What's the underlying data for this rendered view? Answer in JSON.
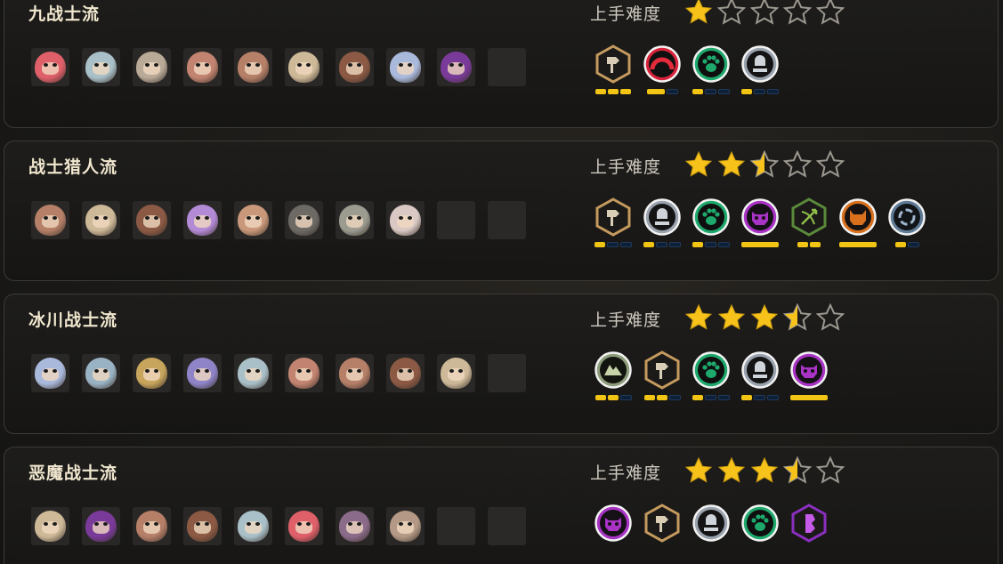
{
  "difficulty_label": "上手难度",
  "colors": {
    "star_on": "#f7c21a",
    "bar_on": "#f2c514",
    "bar_off": "#0e2038"
  },
  "lineups": [
    {
      "name": "九战士流",
      "difficulty": 1,
      "champions": [
        {
          "icon": "pig-warrior-icon",
          "color": "#e0606a"
        },
        {
          "icon": "frost-yeti-icon",
          "color": "#a9c0c8"
        },
        {
          "icon": "stone-golem-icon",
          "color": "#b9aa98"
        },
        {
          "icon": "masked-cat-icon",
          "color": "#c28470"
        },
        {
          "icon": "goggle-pig-icon",
          "color": "#b57f68"
        },
        {
          "icon": "bandana-knight-icon",
          "color": "#cdb898"
        },
        {
          "icon": "bearded-dwarf-icon",
          "color": "#8c5a44"
        },
        {
          "icon": "white-walrus-icon",
          "color": "#a9b9dc"
        },
        {
          "icon": "purple-demon-icon",
          "color": "#7a3a9a"
        },
        {
          "icon": "empty-slot",
          "color": ""
        }
      ],
      "traits": [
        {
          "icon": "warrior-axe-icon",
          "color": "#c59a5e",
          "shape": "hex",
          "bars": [
            1,
            1,
            1
          ]
        },
        {
          "icon": "red-arc-icon",
          "color": "#d8233a",
          "shape": "circle",
          "bars": [
            2,
            0
          ]
        },
        {
          "icon": "beast-paw-icon",
          "color": "#1ea86c",
          "shape": "circle",
          "bars": [
            1,
            0,
            0
          ]
        },
        {
          "icon": "gray-crest-icon",
          "color": "#9aa2ad",
          "shape": "circle",
          "bars": [
            1,
            0,
            0
          ]
        }
      ]
    },
    {
      "name": "战士猎人流",
      "difficulty": 2.5,
      "champions": [
        {
          "icon": "goggle-pig-icon",
          "color": "#b57f68"
        },
        {
          "icon": "bandana-knight-icon",
          "color": "#cdb898"
        },
        {
          "icon": "bearded-dwarf-icon",
          "color": "#8c5a44"
        },
        {
          "icon": "purple-witch-icon",
          "color": "#b38ad6"
        },
        {
          "icon": "goggle-dwarf-icon",
          "color": "#c9987a"
        },
        {
          "icon": "hooded-archer-icon",
          "color": "#6d6a66"
        },
        {
          "icon": "cyborg-icon",
          "color": "#9b9b90"
        },
        {
          "icon": "elder-sage-icon",
          "color": "#d9c8c4"
        },
        {
          "icon": "empty-slot",
          "color": ""
        },
        {
          "icon": "empty-slot",
          "color": ""
        }
      ],
      "traits": [
        {
          "icon": "warrior-axe-icon",
          "color": "#c59a5e",
          "shape": "hex",
          "bars": [
            1,
            0,
            0
          ]
        },
        {
          "icon": "gray-crest-icon",
          "color": "#9aa2ad",
          "shape": "circle",
          "bars": [
            1,
            0,
            0
          ]
        },
        {
          "icon": "beast-paw-icon",
          "color": "#1ea86c",
          "shape": "circle",
          "bars": [
            1,
            0,
            0
          ]
        },
        {
          "icon": "demon-skull-icon",
          "color": "#a833c4",
          "shape": "circle",
          "bars": [
            3
          ]
        },
        {
          "icon": "hunter-bow-icon",
          "color": "#5a8a3a",
          "shape": "hex",
          "bars": [
            1,
            1
          ]
        },
        {
          "icon": "orc-head-icon",
          "color": "#d8701e",
          "shape": "circle",
          "bars": [
            3
          ]
        },
        {
          "icon": "blue-spiral-icon",
          "color": "#5f7b96",
          "shape": "circle",
          "bars": [
            1,
            0
          ]
        }
      ]
    },
    {
      "name": "冰川战士流",
      "difficulty": 3.5,
      "champions": [
        {
          "icon": "white-walrus-icon",
          "color": "#a9b9dc"
        },
        {
          "icon": "horned-ice-icon",
          "color": "#9ab3c4"
        },
        {
          "icon": "gold-mummy-icon",
          "color": "#c7a55c"
        },
        {
          "icon": "ice-bat-icon",
          "color": "#8f84c8"
        },
        {
          "icon": "frost-yeti-icon",
          "color": "#a9c0c8"
        },
        {
          "icon": "masked-cat-icon",
          "color": "#c28470"
        },
        {
          "icon": "goggle-pig-icon",
          "color": "#b57f68"
        },
        {
          "icon": "bearded-dwarf-icon",
          "color": "#8c5a44"
        },
        {
          "icon": "bandana-knight-icon",
          "color": "#cdb898"
        },
        {
          "icon": "empty-slot",
          "color": ""
        }
      ],
      "traits": [
        {
          "icon": "glacier-icon",
          "color": "#8d9c7a",
          "shape": "circle",
          "bars": [
            1,
            1,
            0
          ]
        },
        {
          "icon": "warrior-axe-icon",
          "color": "#c59a5e",
          "shape": "hex",
          "bars": [
            1,
            1,
            0
          ]
        },
        {
          "icon": "beast-paw-icon",
          "color": "#1ea86c",
          "shape": "circle",
          "bars": [
            1,
            0,
            0
          ]
        },
        {
          "icon": "gray-crest-icon",
          "color": "#9aa2ad",
          "shape": "circle",
          "bars": [
            1,
            0,
            0
          ]
        },
        {
          "icon": "demon-skull-icon",
          "color": "#a833c4",
          "shape": "circle",
          "bars": [
            3
          ]
        }
      ]
    },
    {
      "name": "恶魔战士流",
      "difficulty": 3.5,
      "champions": [
        {
          "icon": "bandana-knight-icon",
          "color": "#cdb898"
        },
        {
          "icon": "purple-demon-icon",
          "color": "#7a3a9a"
        },
        {
          "icon": "goggle-pig-icon",
          "color": "#b57f68"
        },
        {
          "icon": "bearded-dwarf-icon",
          "color": "#8c5a44"
        },
        {
          "icon": "frost-yeti-icon",
          "color": "#a9c0c8"
        },
        {
          "icon": "pig-warrior-icon",
          "color": "#e0606a"
        },
        {
          "icon": "hooded-ghost-icon",
          "color": "#8b6b8a"
        },
        {
          "icon": "horned-beast-icon",
          "color": "#b49a86"
        },
        {
          "icon": "empty-slot",
          "color": ""
        },
        {
          "icon": "empty-slot",
          "color": ""
        }
      ],
      "traits": [
        {
          "icon": "demon-skull-icon",
          "color": "#a833c4",
          "shape": "circle",
          "bars": []
        },
        {
          "icon": "warrior-axe-icon",
          "color": "#c59a5e",
          "shape": "hex",
          "bars": []
        },
        {
          "icon": "gray-crest-icon",
          "color": "#9aa2ad",
          "shape": "circle",
          "bars": []
        },
        {
          "icon": "beast-paw-icon",
          "color": "#1ea86c",
          "shape": "circle",
          "bars": []
        },
        {
          "icon": "demon-hunter-icon",
          "color": "#8a2fc0",
          "shape": "hex",
          "bars": []
        }
      ]
    }
  ]
}
